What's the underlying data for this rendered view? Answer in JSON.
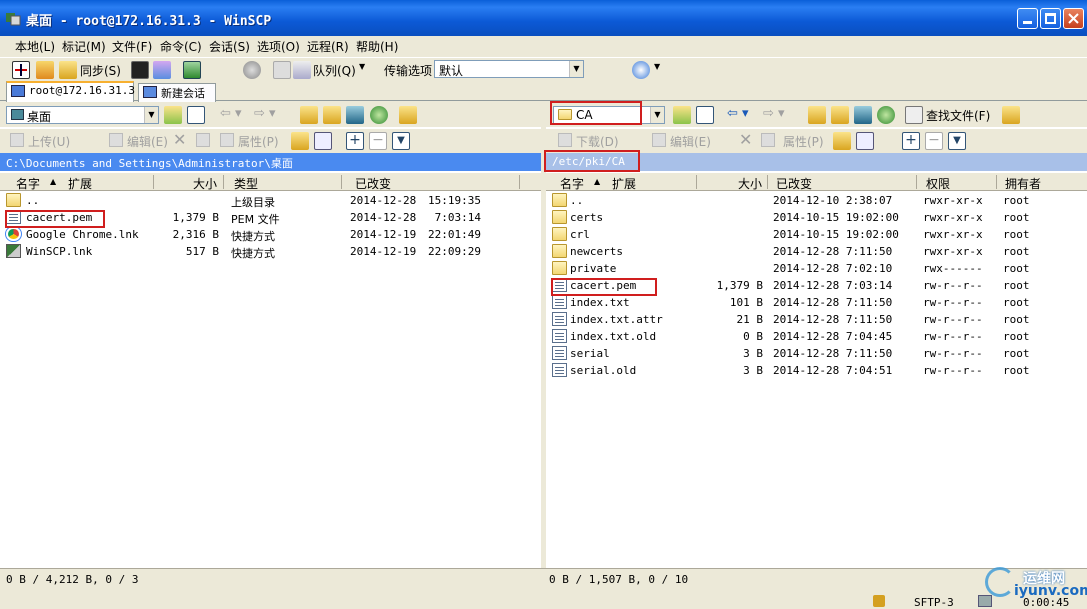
{
  "window": {
    "title": "桌面 - root@172.16.31.3 - WinSCP"
  },
  "menu": [
    "本地(L)",
    "标记(M)",
    "文件(F)",
    "命令(C)",
    "会话(S)",
    "选项(O)",
    "远程(R)",
    "帮助(H)"
  ],
  "toolbar": {
    "sync_label": "同步(S)",
    "queue_label": "队列(Q)",
    "transfer_label": "传输选项",
    "transfer_value": "默认"
  },
  "tabs": [
    {
      "label": "root@172.16.31.3"
    },
    {
      "label": "新建会话"
    }
  ],
  "left": {
    "path_combo": "桌面",
    "actions": {
      "upload": "上传(U)",
      "edit": "编辑(E)",
      "props": "属性(P)"
    },
    "address": "C:\\Documents and Settings\\Administrator\\桌面",
    "columns": [
      "名字",
      "扩展",
      "大小",
      "类型",
      "已改变"
    ],
    "rows": [
      {
        "name": "..",
        "size": "",
        "type": "上级目录",
        "date": "2014-12-28",
        "time": "15:19:35",
        "icon": "parent-dir-icon"
      },
      {
        "name": "cacert.pem",
        "size": "1,379 B",
        "type": "PEM 文件",
        "date": "2014-12-28",
        "time": "7:03:14",
        "icon": "certificate-file-icon"
      },
      {
        "name": "Google Chrome.lnk",
        "size": "2,316 B",
        "type": "快捷方式",
        "date": "2014-12-19",
        "time": "22:01:49",
        "icon": "chrome-icon"
      },
      {
        "name": "WinSCP.lnk",
        "size": "517 B",
        "type": "快捷方式",
        "date": "2014-12-19",
        "time": "22:09:29",
        "icon": "winscp-icon"
      }
    ],
    "status": "0 B / 4,212 B, 0 / 3"
  },
  "right": {
    "path_combo": "CA",
    "find_label": "查找文件(F)",
    "actions": {
      "download": "下载(D)",
      "edit": "编辑(E)",
      "props": "属性(P)"
    },
    "address": "/etc/pki/CA",
    "columns": [
      "名字",
      "扩展",
      "大小",
      "已改变",
      "权限",
      "拥有者"
    ],
    "rows": [
      {
        "name": "..",
        "size": "",
        "changed": "2014-12-10 2:38:07",
        "rights": "rwxr-xr-x",
        "owner": "root",
        "kind": "parent"
      },
      {
        "name": "certs",
        "size": "",
        "changed": "2014-10-15 19:02:00",
        "rights": "rwxr-xr-x",
        "owner": "root",
        "kind": "folder"
      },
      {
        "name": "crl",
        "size": "",
        "changed": "2014-10-15 19:02:00",
        "rights": "rwxr-xr-x",
        "owner": "root",
        "kind": "folder"
      },
      {
        "name": "newcerts",
        "size": "",
        "changed": "2014-12-28 7:11:50",
        "rights": "rwxr-xr-x",
        "owner": "root",
        "kind": "folder"
      },
      {
        "name": "private",
        "size": "",
        "changed": "2014-12-28 7:02:10",
        "rights": "rwx------",
        "owner": "root",
        "kind": "folder"
      },
      {
        "name": "cacert.pem",
        "size": "1,379 B",
        "changed": "2014-12-28 7:03:14",
        "rights": "rw-r--r--",
        "owner": "root",
        "kind": "cert"
      },
      {
        "name": "index.txt",
        "size": "101 B",
        "changed": "2014-12-28 7:11:50",
        "rights": "rw-r--r--",
        "owner": "root",
        "kind": "file"
      },
      {
        "name": "index.txt.attr",
        "size": "21 B",
        "changed": "2014-12-28 7:11:50",
        "rights": "rw-r--r--",
        "owner": "root",
        "kind": "file"
      },
      {
        "name": "index.txt.old",
        "size": "0 B",
        "changed": "2014-12-28 7:04:45",
        "rights": "rw-r--r--",
        "owner": "root",
        "kind": "file"
      },
      {
        "name": "serial",
        "size": "3 B",
        "changed": "2014-12-28 7:11:50",
        "rights": "rw-r--r--",
        "owner": "root",
        "kind": "file"
      },
      {
        "name": "serial.old",
        "size": "3 B",
        "changed": "2014-12-28 7:04:51",
        "rights": "rw-r--r--",
        "owner": "root",
        "kind": "file"
      }
    ],
    "status": "0 B / 1,507 B, 0 / 10"
  },
  "statusbar": {
    "protocol": "SFTP-3",
    "elapsed": "0:00:45"
  },
  "watermark": {
    "text": "运维网",
    "url": "iyunv.com"
  },
  "colors": {
    "address_left": "#4a8af0",
    "address_right": "#a8c0e8",
    "highlight": "#d01e1e"
  }
}
